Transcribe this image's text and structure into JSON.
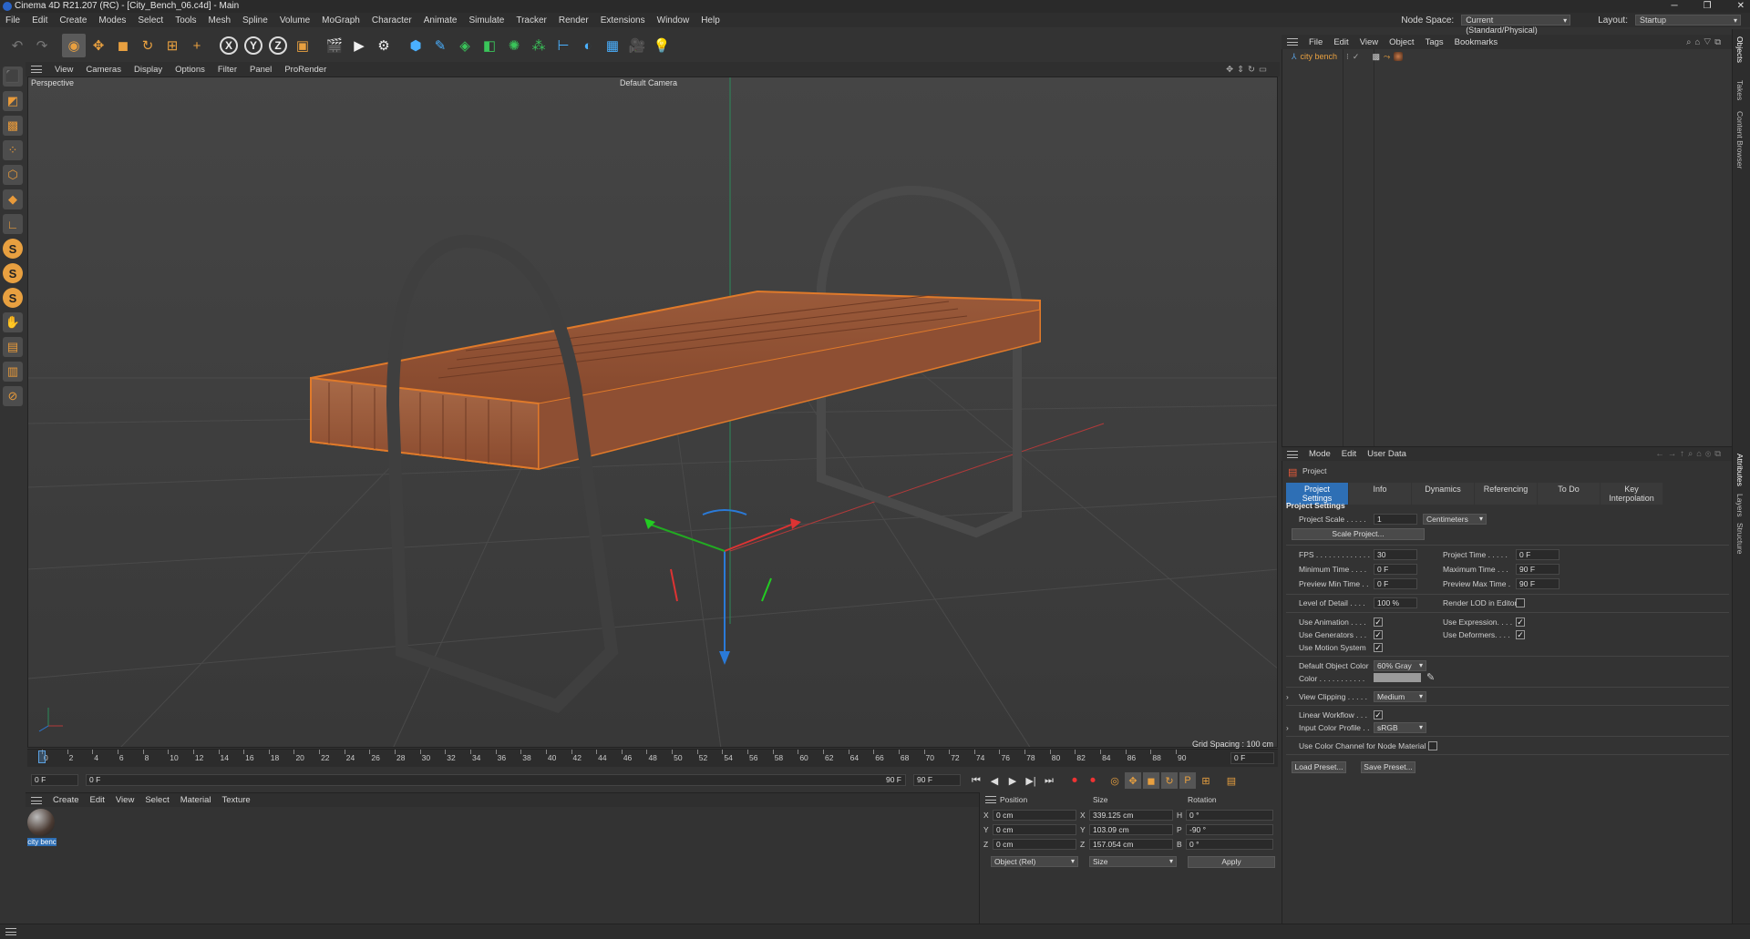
{
  "window": {
    "title": "Cinema 4D R21.207 (RC) - [City_Bench_06.c4d] - Main"
  },
  "menubar": {
    "items": [
      "File",
      "Edit",
      "Create",
      "Modes",
      "Select",
      "Tools",
      "Mesh",
      "Spline",
      "Volume",
      "MoGraph",
      "Character",
      "Animate",
      "Simulate",
      "Tracker",
      "Render",
      "Extensions",
      "Window",
      "Help"
    ],
    "node_space_label": "Node Space:",
    "node_space_value": "Current (Standard/Physical)",
    "layout_label": "Layout:",
    "layout_value": "Startup"
  },
  "viewport": {
    "menu": [
      "View",
      "Cameras",
      "Display",
      "Options",
      "Filter",
      "Panel",
      "ProRender"
    ],
    "view_name": "Perspective",
    "camera_name": "Default Camera",
    "grid_spacing": "Grid Spacing : 100 cm"
  },
  "timeline": {
    "ticks": [
      "0",
      "2",
      "4",
      "6",
      "8",
      "10",
      "12",
      "14",
      "16",
      "18",
      "20",
      "22",
      "24",
      "26",
      "28",
      "30",
      "32",
      "34",
      "36",
      "38",
      "40",
      "42",
      "44",
      "46",
      "48",
      "50",
      "52",
      "54",
      "56",
      "58",
      "60",
      "62",
      "64",
      "66",
      "68",
      "70",
      "72",
      "74",
      "76",
      "78",
      "80",
      "82",
      "84",
      "86",
      "88",
      "90"
    ],
    "current_frame": "0 F",
    "start_field": "0 F",
    "start_field2": "0 F",
    "end_field": "90 F",
    "end_field2": "90 F"
  },
  "material_manager": {
    "menu": [
      "Create",
      "Edit",
      "View",
      "Select",
      "Material",
      "Texture"
    ],
    "materials": [
      {
        "name": "city benc"
      }
    ]
  },
  "coordinates": {
    "headers": [
      "Position",
      "Size",
      "Rotation"
    ],
    "rows": [
      {
        "axis": "X",
        "pos": "0 cm",
        "size_axis": "X",
        "size": "339.125 cm",
        "rot_axis": "H",
        "rot": "0 °"
      },
      {
        "axis": "Y",
        "pos": "0 cm",
        "size_axis": "Y",
        "size": "103.09 cm",
        "rot_axis": "P",
        "rot": "-90 °"
      },
      {
        "axis": "Z",
        "pos": "0 cm",
        "size_axis": "Z",
        "size": "157.054 cm",
        "rot_axis": "B",
        "rot": "0 °"
      }
    ],
    "mode": "Object (Rel)",
    "size_mode": "Size",
    "apply": "Apply"
  },
  "object_manager": {
    "menu": [
      "File",
      "Edit",
      "View",
      "Object",
      "Tags",
      "Bookmarks"
    ],
    "objects": [
      {
        "name": "city bench"
      }
    ]
  },
  "attributes": {
    "menu": [
      "Mode",
      "Edit",
      "User Data"
    ],
    "object_name": "Project",
    "tabs": [
      "Project Settings",
      "Info",
      "Dynamics",
      "Referencing",
      "To Do",
      "Key Interpolation"
    ],
    "section": "Project Settings",
    "project_scale_label": "Project Scale . . . . .",
    "project_scale_value": "1",
    "project_scale_unit": "Centimeters",
    "scale_project_btn": "Scale Project...",
    "fps_label": "FPS . . . . . . . . . . . . .",
    "fps_value": "30",
    "project_time_label": "Project Time . . . . .",
    "project_time_value": "0 F",
    "min_time_label": "Minimum Time . . . .",
    "min_time_value": "0 F",
    "max_time_label": "Maximum Time . . .",
    "max_time_value": "90 F",
    "prev_min_label": "Preview Min Time . .",
    "prev_min_value": "0 F",
    "prev_max_label": "Preview Max Time .",
    "prev_max_value": "90 F",
    "lod_label": "Level of Detail . . . .",
    "lod_value": "100 %",
    "render_lod_label": "Render LOD in Editor",
    "use_anim_label": "Use Animation . . . .",
    "use_expr_label": "Use Expression. . . .",
    "use_gen_label": "Use Generators . . .",
    "use_deform_label": "Use Deformers. . . .",
    "use_motion_label": "Use Motion System",
    "def_color_label": "Default Object Color",
    "def_color_value": "60% Gray",
    "color_label": "Color . . . . . . . . . . .",
    "view_clip_label": "View Clipping . . . . .",
    "view_clip_value": "Medium",
    "linear_label": "Linear Workflow . . .",
    "input_profile_label": "Input Color Profile . .",
    "input_profile_value": "sRGB",
    "node_color_label": "Use Color Channel for Node Material",
    "load_preset": "Load Preset...",
    "save_preset": "Save Preset..."
  },
  "side_tabs": [
    "Objects",
    "Takes",
    "Content Browser",
    "Attributes",
    "Layers",
    "Structure"
  ],
  "colors": {
    "accent": "#2e6fb5",
    "bench_wood": "#8a4a2e",
    "frame": "#3c3c3c",
    "selection_outline": "#e07a2a"
  }
}
